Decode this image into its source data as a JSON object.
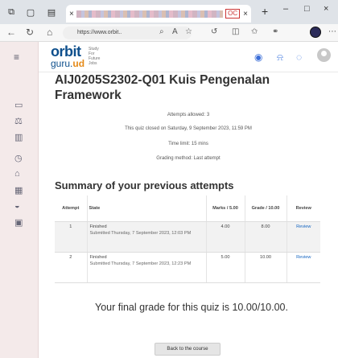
{
  "browser": {
    "tab_close": "×",
    "tab_badge": "OC",
    "new_tab": "+",
    "url": "https://www.orbit..",
    "window_controls": [
      "–",
      "□",
      "×"
    ]
  },
  "site": {
    "logo_main": "orbit",
    "logo_sub_a": "guru.",
    "logo_sub_b": "ud",
    "logo_tagline": "Study For Future Jobs"
  },
  "quiz": {
    "title": "AIJ0205S2302-Q01 Kuis Pengenalan Framework",
    "attempts_allowed": "Attempts allowed: 3",
    "closed": "This quiz closed on Saturday, 9 September 2023, 11:59 PM",
    "time_limit": "Time limit: 15 mins",
    "grading_method": "Grading method: Last attempt"
  },
  "summary": {
    "heading": "Summary of your previous attempts",
    "columns": [
      "Attempt",
      "State",
      "Marks / 5.00",
      "Grade / 10.00",
      "Review"
    ],
    "rows": [
      {
        "attempt": "1",
        "state": "Finished",
        "submitted": "Submitted Thursday, 7 September 2023, 12:03 PM",
        "marks": "4.00",
        "grade": "8.00",
        "review": "Review"
      },
      {
        "attempt": "2",
        "state": "Finished",
        "submitted": "Submitted Thursday, 7 September 2023, 12:23 PM",
        "marks": "5.00",
        "grade": "10.00",
        "review": "Review"
      }
    ]
  },
  "final_grade": "Your final grade for this quiz is 10.00/10.00.",
  "back_button": "Back to the course",
  "colors": {
    "brand_blue": "#0e4f8c",
    "brand_orange": "#e58a19",
    "link": "#1565c0",
    "rail_bg": "#f4eaea"
  },
  "icons": [
    "workspaces-icon",
    "tab-icon",
    "reload-icon",
    "back-icon",
    "lock-icon",
    "reader-icon",
    "favorite-icon",
    "collections-icon",
    "extensions-icon",
    "menu-icon",
    "globe-icon",
    "bell-icon",
    "chat-icon",
    "user-avatar"
  ]
}
